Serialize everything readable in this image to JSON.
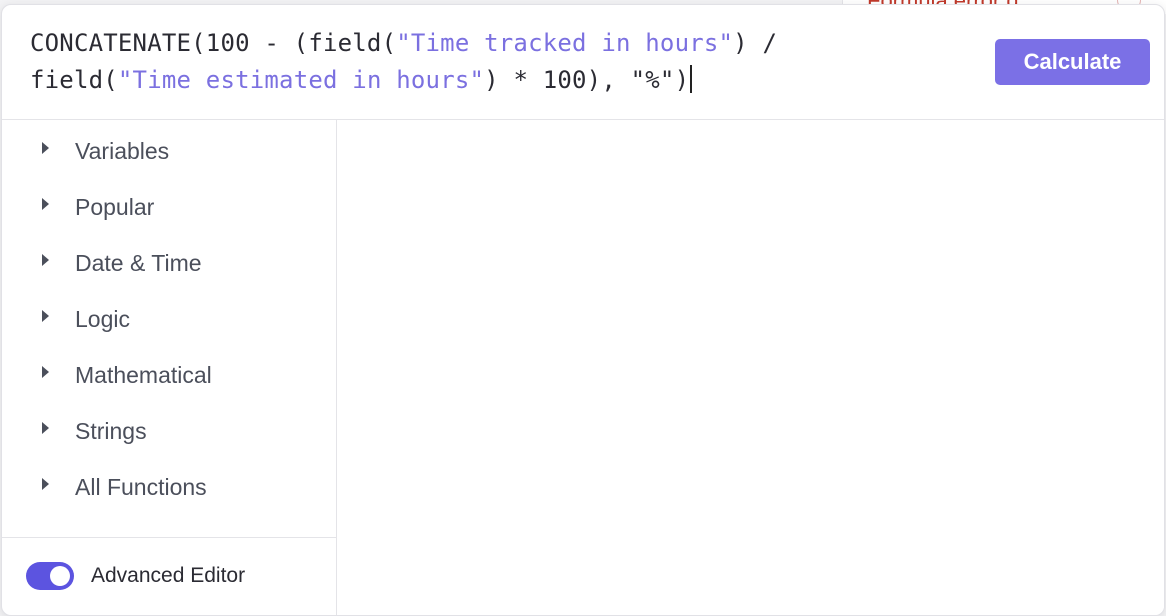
{
  "background": {
    "error_text": "Formula error d"
  },
  "editor": {
    "formula_parts": [
      {
        "text": "CONCATENATE(100 - (field(",
        "type": "code"
      },
      {
        "text": "\"Time tracked in hours\"",
        "type": "string"
      },
      {
        "text": ") /",
        "type": "code"
      },
      {
        "text": "field(",
        "type": "code"
      },
      {
        "text": "\"Time estimated in hours\"",
        "type": "string"
      },
      {
        "text": ") * 100), \"%\")",
        "type": "code"
      }
    ],
    "calculate_label": "Calculate"
  },
  "sidebar": {
    "categories": [
      {
        "label": "Variables"
      },
      {
        "label": "Popular"
      },
      {
        "label": "Date & Time"
      },
      {
        "label": "Logic"
      },
      {
        "label": "Mathematical"
      },
      {
        "label": "Strings"
      },
      {
        "label": "All Functions"
      }
    ],
    "advanced_editor": {
      "label": "Advanced Editor",
      "enabled": true
    }
  },
  "colors": {
    "accent": "#7b70e6",
    "toggle_on": "#5c54e0",
    "string_literal": "#7b70e0",
    "text": "#4b4f5b"
  }
}
